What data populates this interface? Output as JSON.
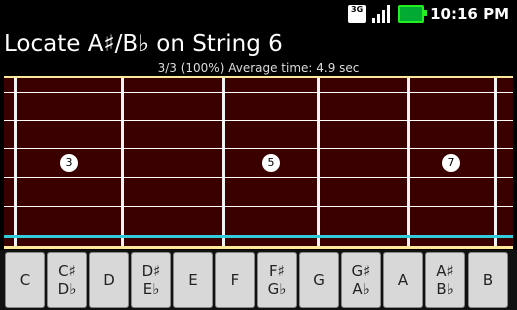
{
  "status_bar": {
    "time": "10:16 PM",
    "network": "3G"
  },
  "title": "Locate A♯/B♭ on String 6",
  "stats": "3/3 (100%)  Average time: 4.9 sec",
  "fret_markers": [
    "3",
    "5",
    "7"
  ],
  "highlighted_string": 6,
  "note_keys": [
    {
      "top": "C"
    },
    {
      "top": "C♯",
      "bottom": "D♭"
    },
    {
      "top": "D"
    },
    {
      "top": "D♯",
      "bottom": "E♭"
    },
    {
      "top": "E"
    },
    {
      "top": "F"
    },
    {
      "top": "F♯",
      "bottom": "G♭"
    },
    {
      "top": "G"
    },
    {
      "top": "G♯",
      "bottom": "A♭"
    },
    {
      "top": "A"
    },
    {
      "top": "A♯",
      "bottom": "B♭"
    },
    {
      "top": "B"
    }
  ],
  "colors": {
    "fretboard": "#3a0000",
    "highlight_string": "#33ccdd",
    "edge": "#ffe89a"
  }
}
